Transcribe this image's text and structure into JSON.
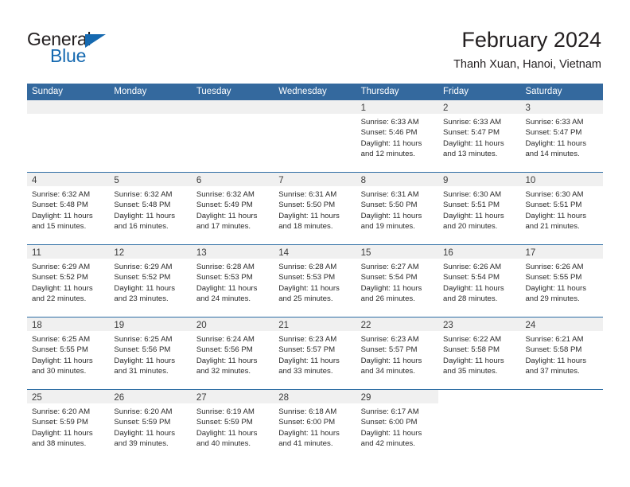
{
  "brand": {
    "name_top": "General",
    "name_bottom": "Blue",
    "triangle_icon": "blue-triangle-logo-mark",
    "color_dark": "#231f20",
    "color_blue": "#1569b0"
  },
  "header": {
    "title": "February 2024",
    "subtitle": "Thanh Xuan, Hanoi, Vietnam"
  },
  "colors": {
    "header_bar": "#34699e",
    "row_separator": "#2e6da4",
    "date_band": "#f0f0f0",
    "text": "#2b2b2b"
  },
  "weekdays": [
    "Sunday",
    "Monday",
    "Tuesday",
    "Wednesday",
    "Thursday",
    "Friday",
    "Saturday"
  ],
  "calendar": {
    "month": "February",
    "year": "2024",
    "location": "Thanh Xuan, Hanoi, Vietnam",
    "labels": {
      "sunrise": "Sunrise:",
      "sunset": "Sunset:",
      "daylight": "Daylight:"
    },
    "weeks": [
      [
        {
          "date": "",
          "empty": true
        },
        {
          "date": "",
          "empty": true
        },
        {
          "date": "",
          "empty": true
        },
        {
          "date": "",
          "empty": true
        },
        {
          "date": "1",
          "sunrise": "Sunrise: 6:33 AM",
          "sunset": "Sunset: 5:46 PM",
          "daylight_line1": "Daylight: 11 hours",
          "daylight_line2": "and 12 minutes."
        },
        {
          "date": "2",
          "sunrise": "Sunrise: 6:33 AM",
          "sunset": "Sunset: 5:47 PM",
          "daylight_line1": "Daylight: 11 hours",
          "daylight_line2": "and 13 minutes."
        },
        {
          "date": "3",
          "sunrise": "Sunrise: 6:33 AM",
          "sunset": "Sunset: 5:47 PM",
          "daylight_line1": "Daylight: 11 hours",
          "daylight_line2": "and 14 minutes."
        }
      ],
      [
        {
          "date": "4",
          "sunrise": "Sunrise: 6:32 AM",
          "sunset": "Sunset: 5:48 PM",
          "daylight_line1": "Daylight: 11 hours",
          "daylight_line2": "and 15 minutes."
        },
        {
          "date": "5",
          "sunrise": "Sunrise: 6:32 AM",
          "sunset": "Sunset: 5:48 PM",
          "daylight_line1": "Daylight: 11 hours",
          "daylight_line2": "and 16 minutes."
        },
        {
          "date": "6",
          "sunrise": "Sunrise: 6:32 AM",
          "sunset": "Sunset: 5:49 PM",
          "daylight_line1": "Daylight: 11 hours",
          "daylight_line2": "and 17 minutes."
        },
        {
          "date": "7",
          "sunrise": "Sunrise: 6:31 AM",
          "sunset": "Sunset: 5:50 PM",
          "daylight_line1": "Daylight: 11 hours",
          "daylight_line2": "and 18 minutes."
        },
        {
          "date": "8",
          "sunrise": "Sunrise: 6:31 AM",
          "sunset": "Sunset: 5:50 PM",
          "daylight_line1": "Daylight: 11 hours",
          "daylight_line2": "and 19 minutes."
        },
        {
          "date": "9",
          "sunrise": "Sunrise: 6:30 AM",
          "sunset": "Sunset: 5:51 PM",
          "daylight_line1": "Daylight: 11 hours",
          "daylight_line2": "and 20 minutes."
        },
        {
          "date": "10",
          "sunrise": "Sunrise: 6:30 AM",
          "sunset": "Sunset: 5:51 PM",
          "daylight_line1": "Daylight: 11 hours",
          "daylight_line2": "and 21 minutes."
        }
      ],
      [
        {
          "date": "11",
          "sunrise": "Sunrise: 6:29 AM",
          "sunset": "Sunset: 5:52 PM",
          "daylight_line1": "Daylight: 11 hours",
          "daylight_line2": "and 22 minutes."
        },
        {
          "date": "12",
          "sunrise": "Sunrise: 6:29 AM",
          "sunset": "Sunset: 5:52 PM",
          "daylight_line1": "Daylight: 11 hours",
          "daylight_line2": "and 23 minutes."
        },
        {
          "date": "13",
          "sunrise": "Sunrise: 6:28 AM",
          "sunset": "Sunset: 5:53 PM",
          "daylight_line1": "Daylight: 11 hours",
          "daylight_line2": "and 24 minutes."
        },
        {
          "date": "14",
          "sunrise": "Sunrise: 6:28 AM",
          "sunset": "Sunset: 5:53 PM",
          "daylight_line1": "Daylight: 11 hours",
          "daylight_line2": "and 25 minutes."
        },
        {
          "date": "15",
          "sunrise": "Sunrise: 6:27 AM",
          "sunset": "Sunset: 5:54 PM",
          "daylight_line1": "Daylight: 11 hours",
          "daylight_line2": "and 26 minutes."
        },
        {
          "date": "16",
          "sunrise": "Sunrise: 6:26 AM",
          "sunset": "Sunset: 5:54 PM",
          "daylight_line1": "Daylight: 11 hours",
          "daylight_line2": "and 28 minutes."
        },
        {
          "date": "17",
          "sunrise": "Sunrise: 6:26 AM",
          "sunset": "Sunset: 5:55 PM",
          "daylight_line1": "Daylight: 11 hours",
          "daylight_line2": "and 29 minutes."
        }
      ],
      [
        {
          "date": "18",
          "sunrise": "Sunrise: 6:25 AM",
          "sunset": "Sunset: 5:55 PM",
          "daylight_line1": "Daylight: 11 hours",
          "daylight_line2": "and 30 minutes."
        },
        {
          "date": "19",
          "sunrise": "Sunrise: 6:25 AM",
          "sunset": "Sunset: 5:56 PM",
          "daylight_line1": "Daylight: 11 hours",
          "daylight_line2": "and 31 minutes."
        },
        {
          "date": "20",
          "sunrise": "Sunrise: 6:24 AM",
          "sunset": "Sunset: 5:56 PM",
          "daylight_line1": "Daylight: 11 hours",
          "daylight_line2": "and 32 minutes."
        },
        {
          "date": "21",
          "sunrise": "Sunrise: 6:23 AM",
          "sunset": "Sunset: 5:57 PM",
          "daylight_line1": "Daylight: 11 hours",
          "daylight_line2": "and 33 minutes."
        },
        {
          "date": "22",
          "sunrise": "Sunrise: 6:23 AM",
          "sunset": "Sunset: 5:57 PM",
          "daylight_line1": "Daylight: 11 hours",
          "daylight_line2": "and 34 minutes."
        },
        {
          "date": "23",
          "sunrise": "Sunrise: 6:22 AM",
          "sunset": "Sunset: 5:58 PM",
          "daylight_line1": "Daylight: 11 hours",
          "daylight_line2": "and 35 minutes."
        },
        {
          "date": "24",
          "sunrise": "Sunrise: 6:21 AM",
          "sunset": "Sunset: 5:58 PM",
          "daylight_line1": "Daylight: 11 hours",
          "daylight_line2": "and 37 minutes."
        }
      ],
      [
        {
          "date": "25",
          "sunrise": "Sunrise: 6:20 AM",
          "sunset": "Sunset: 5:59 PM",
          "daylight_line1": "Daylight: 11 hours",
          "daylight_line2": "and 38 minutes."
        },
        {
          "date": "26",
          "sunrise": "Sunrise: 6:20 AM",
          "sunset": "Sunset: 5:59 PM",
          "daylight_line1": "Daylight: 11 hours",
          "daylight_line2": "and 39 minutes."
        },
        {
          "date": "27",
          "sunrise": "Sunrise: 6:19 AM",
          "sunset": "Sunset: 5:59 PM",
          "daylight_line1": "Daylight: 11 hours",
          "daylight_line2": "and 40 minutes."
        },
        {
          "date": "28",
          "sunrise": "Sunrise: 6:18 AM",
          "sunset": "Sunset: 6:00 PM",
          "daylight_line1": "Daylight: 11 hours",
          "daylight_line2": "and 41 minutes."
        },
        {
          "date": "29",
          "sunrise": "Sunrise: 6:17 AM",
          "sunset": "Sunset: 6:00 PM",
          "daylight_line1": "Daylight: 11 hours",
          "daylight_line2": "and 42 minutes."
        },
        {
          "date": "",
          "empty": true,
          "no_band": true
        },
        {
          "date": "",
          "empty": true,
          "no_band": true
        }
      ]
    ]
  }
}
